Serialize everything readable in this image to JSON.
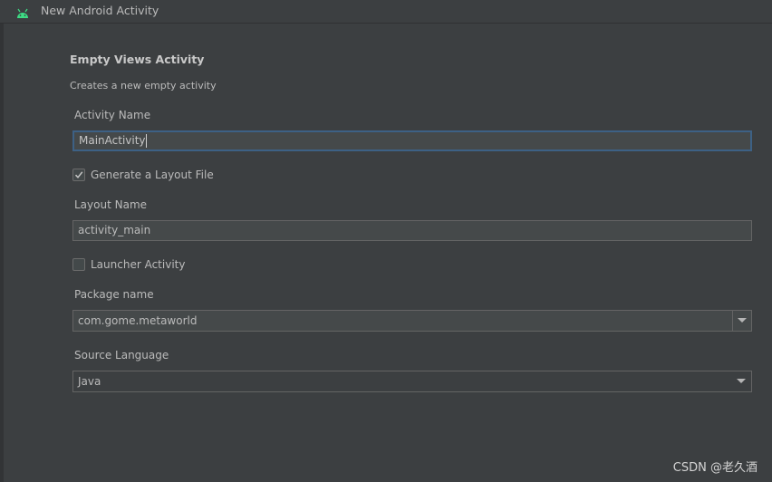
{
  "window": {
    "title": "New Android Activity",
    "icon": "android-icon",
    "accent_color": "#3ddc84"
  },
  "form": {
    "heading": "Empty Views Activity",
    "description": "Creates a new empty activity",
    "activity_name": {
      "label": "Activity Name",
      "value": "MainActivity"
    },
    "generate_layout": {
      "label": "Generate a Layout File",
      "checked": true
    },
    "layout_name": {
      "label": "Layout Name",
      "value": "activity_main"
    },
    "launcher_activity": {
      "label": "Launcher Activity",
      "checked": false
    },
    "package_name": {
      "label": "Package name",
      "value": "com.gome.metaworld"
    },
    "source_language": {
      "label": "Source Language",
      "value": "Java"
    }
  },
  "watermark": "CSDN @老久酒"
}
